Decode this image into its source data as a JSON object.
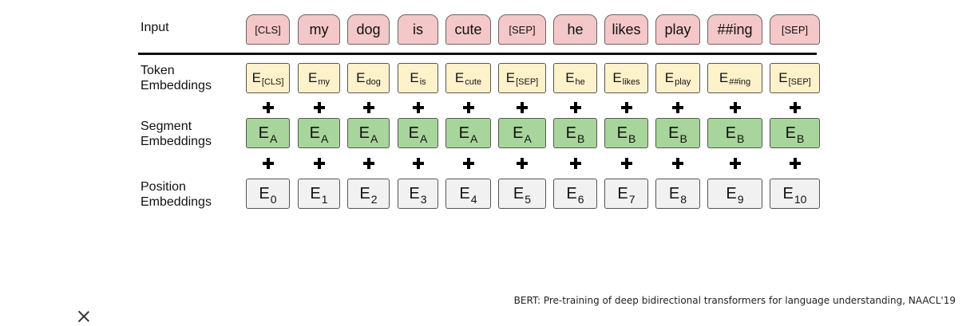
{
  "labels": {
    "input": "Input",
    "token": [
      "Token",
      "Embeddings"
    ],
    "segment": [
      "Segment",
      "Embeddings"
    ],
    "position": [
      "Position",
      "Embeddings"
    ]
  },
  "input_tokens": [
    "[CLS]",
    "my",
    "dog",
    "is",
    "cute",
    "[SEP]",
    "he",
    "likes",
    "play",
    "##ing",
    "[SEP]"
  ],
  "token_embeddings": [
    {
      "base": "E",
      "sub": "[CLS]"
    },
    {
      "base": "E",
      "sub": "my"
    },
    {
      "base": "E",
      "sub": "dog"
    },
    {
      "base": "E",
      "sub": "is"
    },
    {
      "base": "E",
      "sub": "cute"
    },
    {
      "base": "E",
      "sub": "[SEP]"
    },
    {
      "base": "E",
      "sub": "he"
    },
    {
      "base": "E",
      "sub": "likes"
    },
    {
      "base": "E",
      "sub": "play"
    },
    {
      "base": "E",
      "sub": "##ing"
    },
    {
      "base": "E",
      "sub": "[SEP]"
    }
  ],
  "segment_embeddings": [
    {
      "base": "E",
      "sub": "A"
    },
    {
      "base": "E",
      "sub": "A"
    },
    {
      "base": "E",
      "sub": "A"
    },
    {
      "base": "E",
      "sub": "A"
    },
    {
      "base": "E",
      "sub": "A"
    },
    {
      "base": "E",
      "sub": "A"
    },
    {
      "base": "E",
      "sub": "B"
    },
    {
      "base": "E",
      "sub": "B"
    },
    {
      "base": "E",
      "sub": "B"
    },
    {
      "base": "E",
      "sub": "B"
    },
    {
      "base": "E",
      "sub": "B"
    }
  ],
  "position_embeddings": [
    {
      "base": "E",
      "sub": "0"
    },
    {
      "base": "E",
      "sub": "1"
    },
    {
      "base": "E",
      "sub": "2"
    },
    {
      "base": "E",
      "sub": "3"
    },
    {
      "base": "E",
      "sub": "4"
    },
    {
      "base": "E",
      "sub": "5"
    },
    {
      "base": "E",
      "sub": "6"
    },
    {
      "base": "E",
      "sub": "7"
    },
    {
      "base": "E",
      "sub": "8"
    },
    {
      "base": "E",
      "sub": "9"
    },
    {
      "base": "E",
      "sub": "10"
    }
  ],
  "colors": {
    "input": "#f4c7c8",
    "token": "#fef2cb",
    "segment": "#a8d59b",
    "position": "#f1f1f1"
  },
  "citation": "BERT: Pre-training of deep bidirectional transformers for language understanding, NAACL'19",
  "icons": {
    "close": "close-icon"
  }
}
